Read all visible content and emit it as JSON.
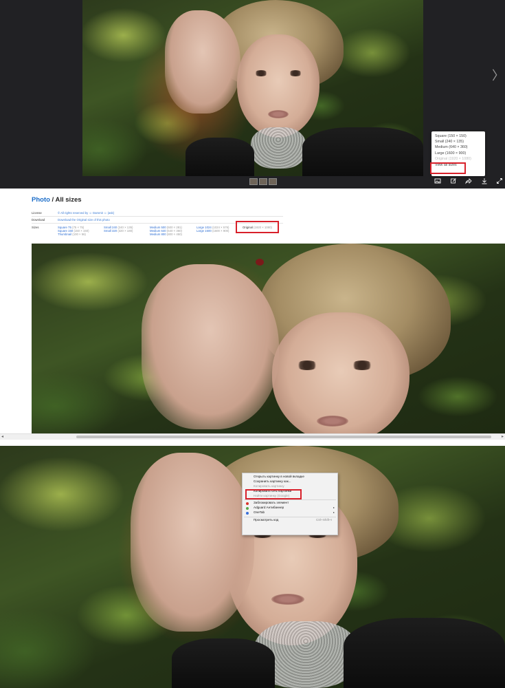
{
  "viewer": {
    "next_arrow": "〉",
    "toolbar_icons": [
      "image-icon",
      "edit-icon",
      "share-icon",
      "download-icon",
      "fullscreen-icon"
    ],
    "download_menu": {
      "items": [
        "Square (150 × 150)",
        "Small (240 × 135)",
        "Medium (640 × 360)",
        "Large (1600 × 900)",
        "Original (1920 × 1080)"
      ],
      "view_all": "View all sizes"
    }
  },
  "sizes_page": {
    "heading_crumb": "Photo",
    "heading_sep": " / ",
    "heading_title": "All sizes",
    "license_label": "License",
    "license_value": "© All rights reserved by ☺ Dammit ☺ (ask)",
    "download_label": "Download",
    "download_value": "Download the Original size of this photo",
    "sizes_label": "Sizes",
    "col1": [
      {
        "name": "Square 75",
        "px": "(75 × 75)"
      },
      {
        "name": "Square 150",
        "px": "(150 × 150)"
      },
      {
        "name": "Thumbnail",
        "px": "(100 × 56)"
      }
    ],
    "col2": [
      {
        "name": "Small 240",
        "px": "(240 × 135)"
      },
      {
        "name": "Small 320",
        "px": "(320 × 180)"
      }
    ],
    "col3": [
      {
        "name": "Medium 500",
        "px": "(500 × 281)"
      },
      {
        "name": "Medium 640",
        "px": "(640 × 360)"
      },
      {
        "name": "Medium 800",
        "px": "(800 × 450)"
      }
    ],
    "col4": [
      {
        "name": "Large 1024",
        "px": "(1024 × 576)"
      },
      {
        "name": "Large 1600",
        "px": "(1600 × 900)"
      }
    ],
    "original": {
      "name": "Original",
      "px": "(1920 × 1080)"
    },
    "scroll_left": "◂",
    "scroll_right": "▸"
  },
  "context_menu": {
    "items": [
      {
        "label": "Открыть картинку в новой вкладке",
        "faded": false
      },
      {
        "label": "Сохранить картинку как...",
        "faded": false
      },
      {
        "label": "Копировать картинку",
        "faded": true
      },
      {
        "label": "Копировать URL картинки",
        "faded": false
      },
      {
        "label": "Найти картинку (Google)",
        "faded": true
      }
    ],
    "ext_items": [
      {
        "label": "Заблокировать элемент",
        "icon_color": "#d9342b",
        "arrow": ""
      },
      {
        "label": "Adguard Антибаннер",
        "icon_color": "#58a84a",
        "arrow": "▸"
      },
      {
        "label": "OneTab",
        "icon_color": "#3a6fd8",
        "arrow": "▸"
      }
    ],
    "inspect": {
      "label": "Просмотреть код",
      "shortcut": "Ctrl+Shift+I"
    }
  },
  "colors": {
    "highlight": "#d8202a",
    "link": "#1a6cc8",
    "viewer_bg": "#212124"
  }
}
